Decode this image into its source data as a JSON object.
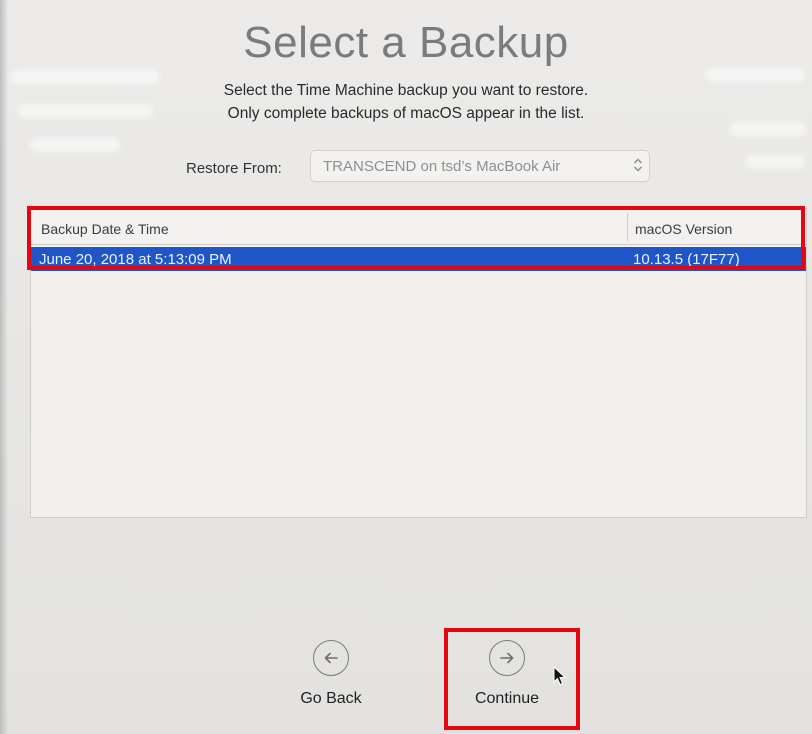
{
  "page": {
    "title": "Select a Backup",
    "subtitle_line1": "Select the Time Machine backup you want to restore.",
    "subtitle_line2": "Only complete backups of macOS appear in the list."
  },
  "restore": {
    "label": "Restore From:",
    "selected_value": "TRANSCEND on tsd’s MacBook Air"
  },
  "table": {
    "columns": [
      "Backup Date & Time",
      "macOS Version"
    ],
    "rows": [
      {
        "date": "June 20, 2018 at 5:13:09 PM",
        "version": "10.13.5 (17F77)",
        "selected": true
      }
    ]
  },
  "nav": {
    "back_label": "Go Back",
    "continue_label": "Continue"
  },
  "icons": {
    "back": "arrow-left-circle-icon",
    "continue": "arrow-right-circle-icon",
    "select": "chevron-up-down-icon",
    "cursor": "mouse-pointer-icon"
  },
  "colors": {
    "selection": "#1f56c7",
    "annotation": "#e30613",
    "title": "#7b7b7b"
  }
}
